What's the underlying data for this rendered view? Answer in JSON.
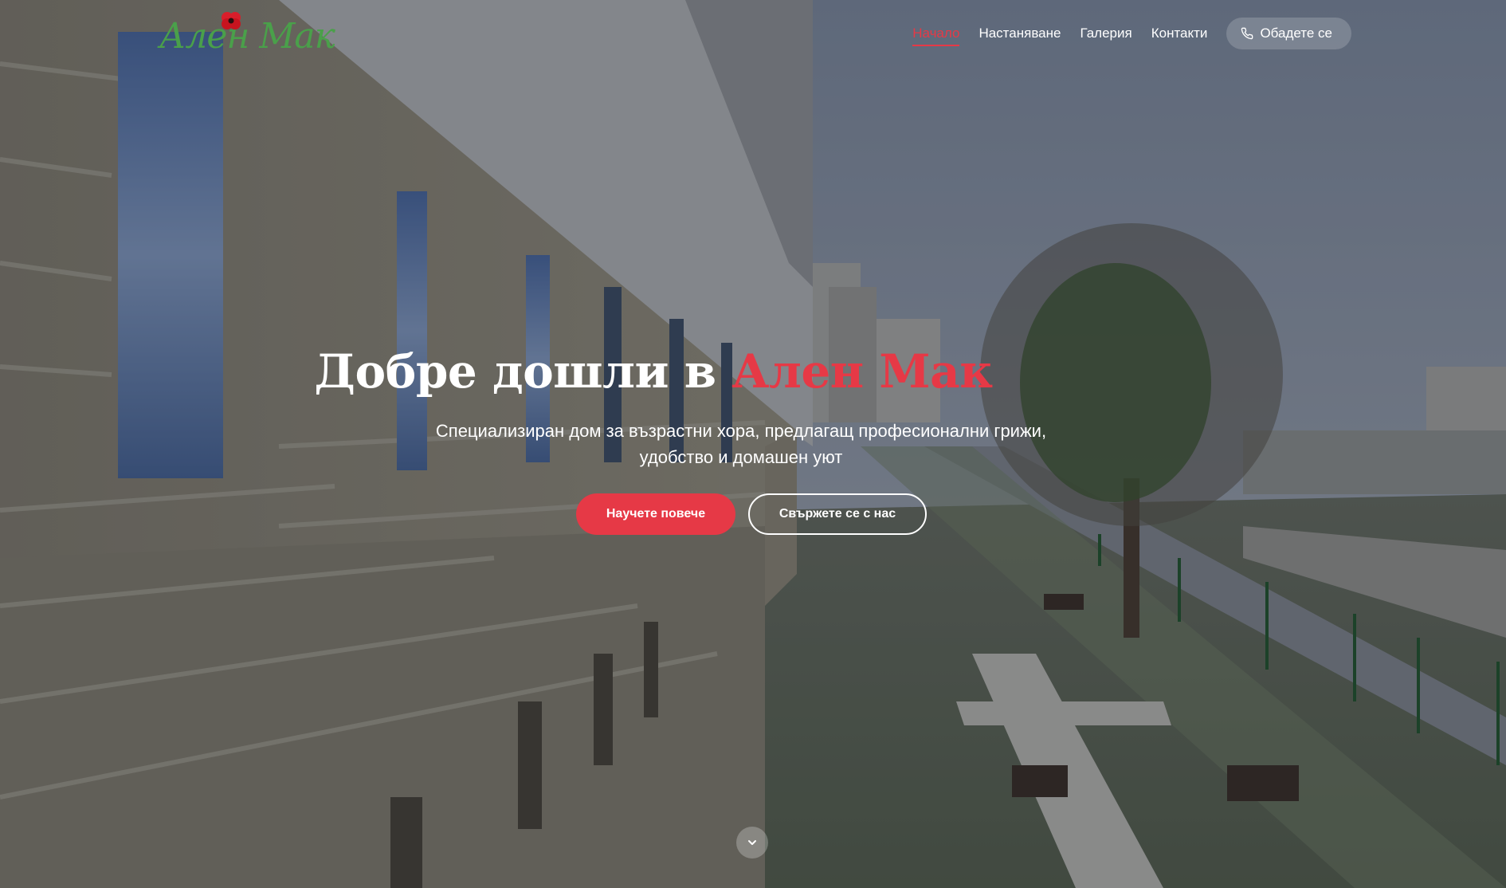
{
  "brand": {
    "logo_text": "Ален Мак",
    "accent_color": "#e63946",
    "logo_color": "#4aa04a"
  },
  "nav": {
    "items": [
      {
        "label": "Начало",
        "active": true
      },
      {
        "label": "Настаняване",
        "active": false
      },
      {
        "label": "Галерия",
        "active": false
      },
      {
        "label": "Контакти",
        "active": false
      }
    ],
    "call_label": "Обадете се",
    "call_icon": "phone-icon"
  },
  "hero": {
    "title_prefix": "Добре дошли в ",
    "title_accent": "Ален Мак",
    "subtitle": "Специализиран дом за възрастни хора, предлагащ професионални грижи, удобство и домашен уют",
    "primary_button": "Научете повече",
    "secondary_button": "Свържете се с нас",
    "scroll_icon": "chevron-down-icon"
  }
}
